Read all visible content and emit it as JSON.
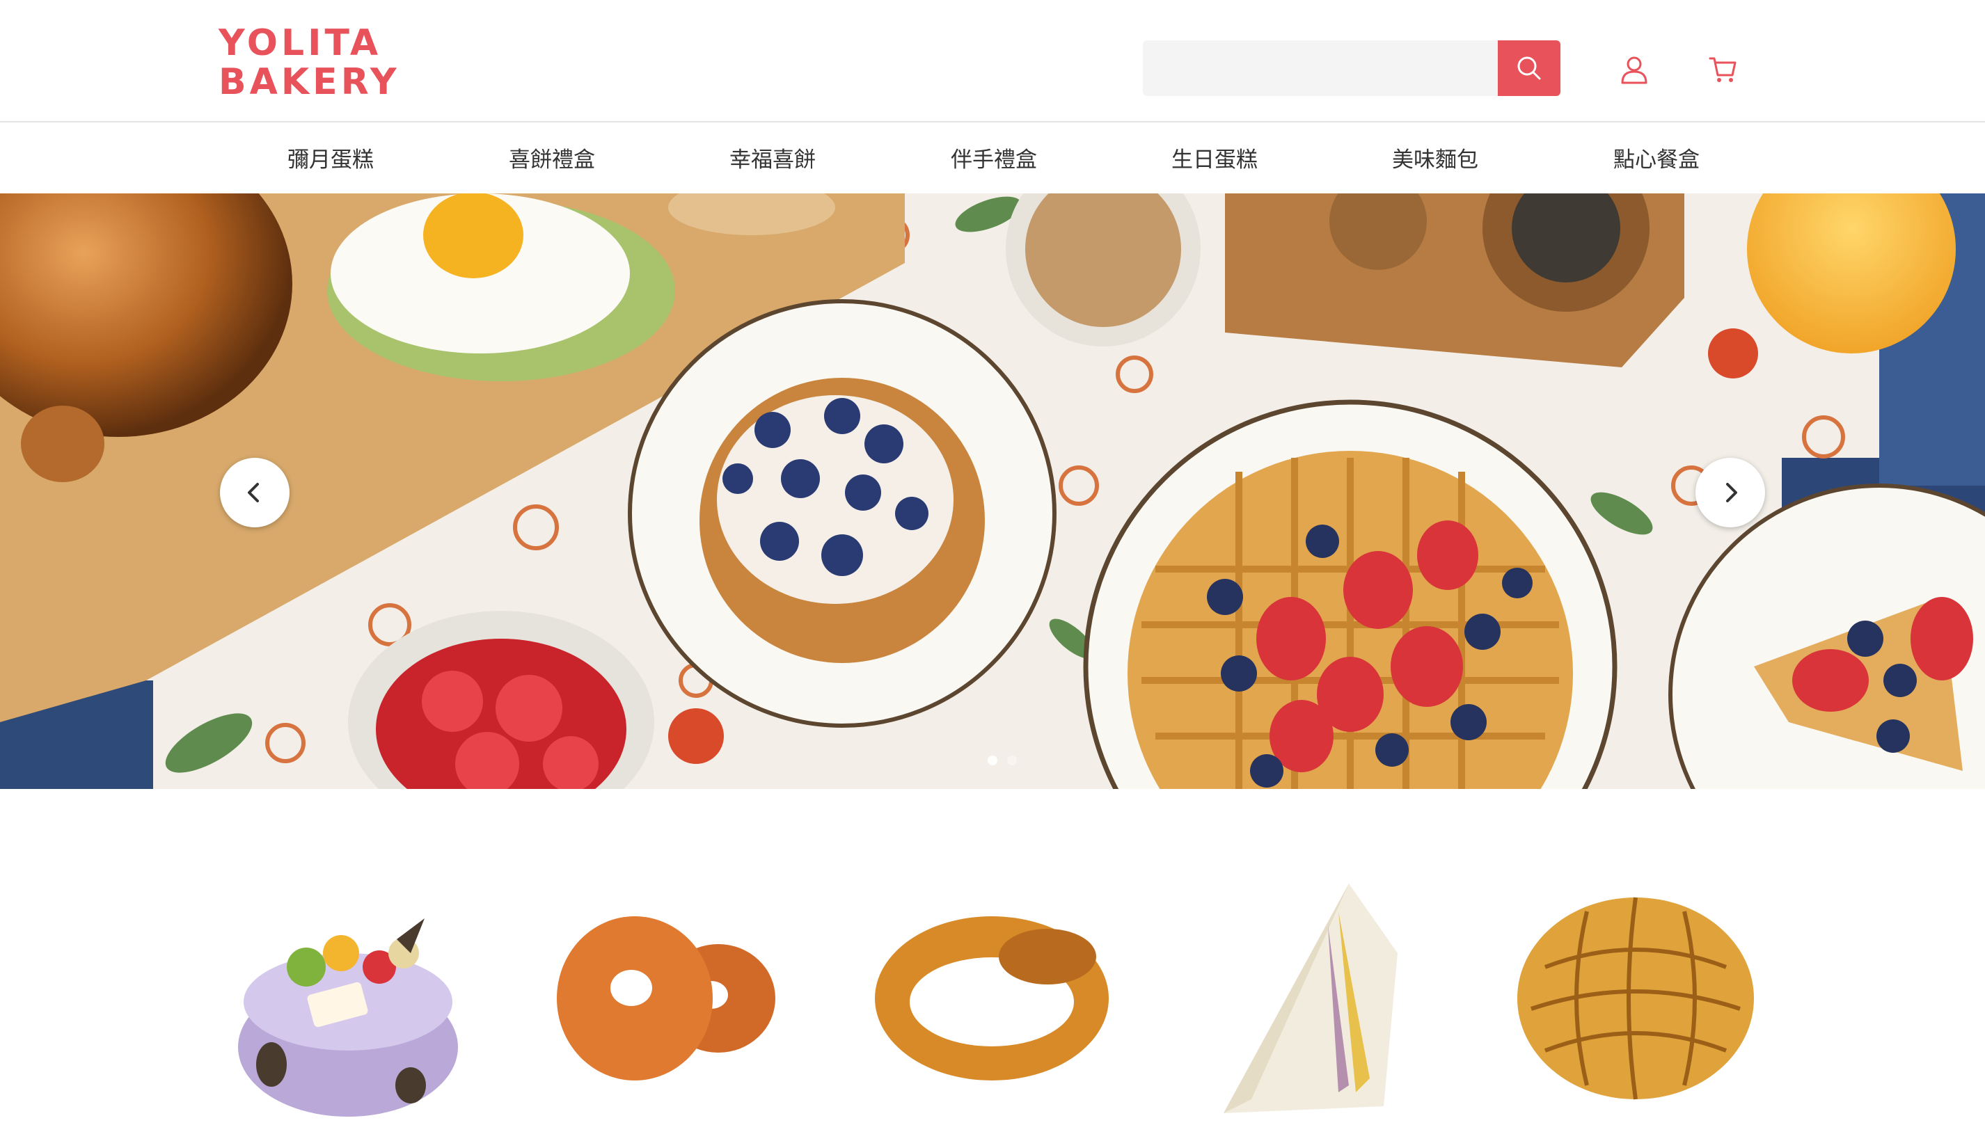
{
  "brand": {
    "line1": "YOLITA",
    "line2": "BAKERY",
    "color": "#e8525a"
  },
  "search": {
    "placeholder": "",
    "value": ""
  },
  "icons": {
    "search": "search-icon",
    "user": "user-icon",
    "cart": "cart-icon"
  },
  "nav": {
    "items": [
      {
        "label": "彌月蛋糕"
      },
      {
        "label": "喜餅禮盒"
      },
      {
        "label": "幸福喜餅"
      },
      {
        "label": "伴手禮盒"
      },
      {
        "label": "生日蛋糕"
      },
      {
        "label": "美味麵包"
      },
      {
        "label": "點心餐盒"
      }
    ]
  },
  "carousel": {
    "slide_count": 2,
    "active_index": 0
  },
  "products": [
    {
      "name": "birthday-cake"
    },
    {
      "name": "donut"
    },
    {
      "name": "pretzel"
    },
    {
      "name": "sandwich"
    },
    {
      "name": "pineapple-bun"
    }
  ]
}
